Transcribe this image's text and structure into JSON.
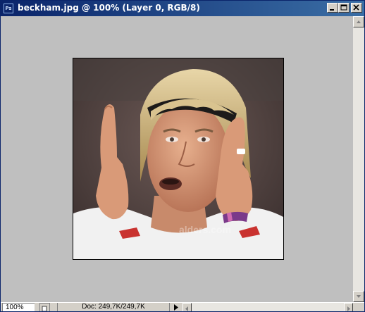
{
  "window": {
    "title": "beckham.jpg @ 100% (Layer 0, RGB/8)",
    "app_icon": "Ps"
  },
  "statusbar": {
    "zoom": "100%",
    "doc_info": "Doc: 249,7K/249,7K"
  },
  "canvas": {
    "image_description": "photo",
    "watermark": "alders.com"
  },
  "colors": {
    "titlebar_start": "#0a246a",
    "titlebar_end": "#3a6ea5",
    "canvas_bg": "#bfbfbf",
    "chrome": "#d4d0c8"
  },
  "icons": [
    "app-icon",
    "minimize-icon",
    "maximize-icon",
    "close-icon",
    "scroll-up-icon",
    "scroll-down-icon",
    "scroll-left-icon",
    "scroll-right-icon",
    "status-menu-arrow-icon"
  ]
}
